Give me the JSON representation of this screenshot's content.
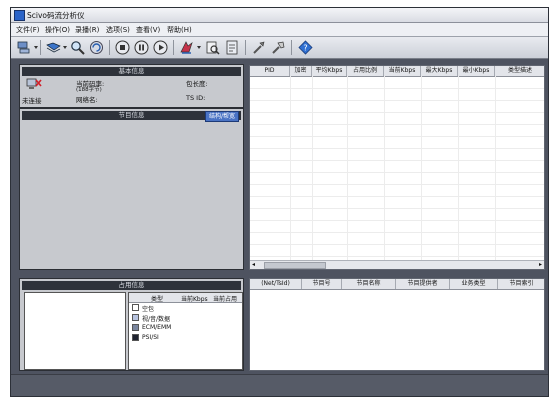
{
  "window": {
    "title": "Scivo码流分析仪"
  },
  "menu": [
    "文件(F)",
    "操作(O)",
    "录播(R)",
    "选项(S)",
    "查看(V)",
    "帮助(H)"
  ],
  "toolbar": {
    "buttons": [
      "connect",
      "open-stream",
      "search",
      "refresh",
      "stop",
      "pause",
      "play",
      "record",
      "analyze",
      "report",
      "settings",
      "tools",
      "help"
    ]
  },
  "basic_panel": {
    "title": "基本信息",
    "status": "未连接",
    "rate_label": "当前码率:",
    "rate_sub": "(188字节)",
    "network_label": "网络名:",
    "pkt_len_label": "包长度:",
    "ts_id_label": "TS ID:"
  },
  "program_panel": {
    "title": "节目信息",
    "button": "结构/帮宽"
  },
  "pid_table": {
    "columns": [
      "PID",
      "加密",
      "平均Kbps",
      "占用比例",
      "当前Kbps",
      "最大Kbps",
      "最小Kbps",
      "类型描述"
    ]
  },
  "service_table": {
    "columns": [
      "(Net/TsId)",
      "节目号",
      "节目名称",
      "节目提供者",
      "业务类型",
      "节目索引"
    ]
  },
  "bandwidth_panel": {
    "title": "占用信息",
    "columns": [
      "类型",
      "当前Kbps",
      "当前占用"
    ],
    "legend": [
      {
        "label": "空包",
        "color": "#ffffff"
      },
      {
        "label": "视/音/数据",
        "color": "#b7c3e0"
      },
      {
        "label": "ECM/EMM",
        "color": "#7a869f"
      },
      {
        "label": "PSI/SI",
        "color": "#1f2330"
      }
    ]
  }
}
